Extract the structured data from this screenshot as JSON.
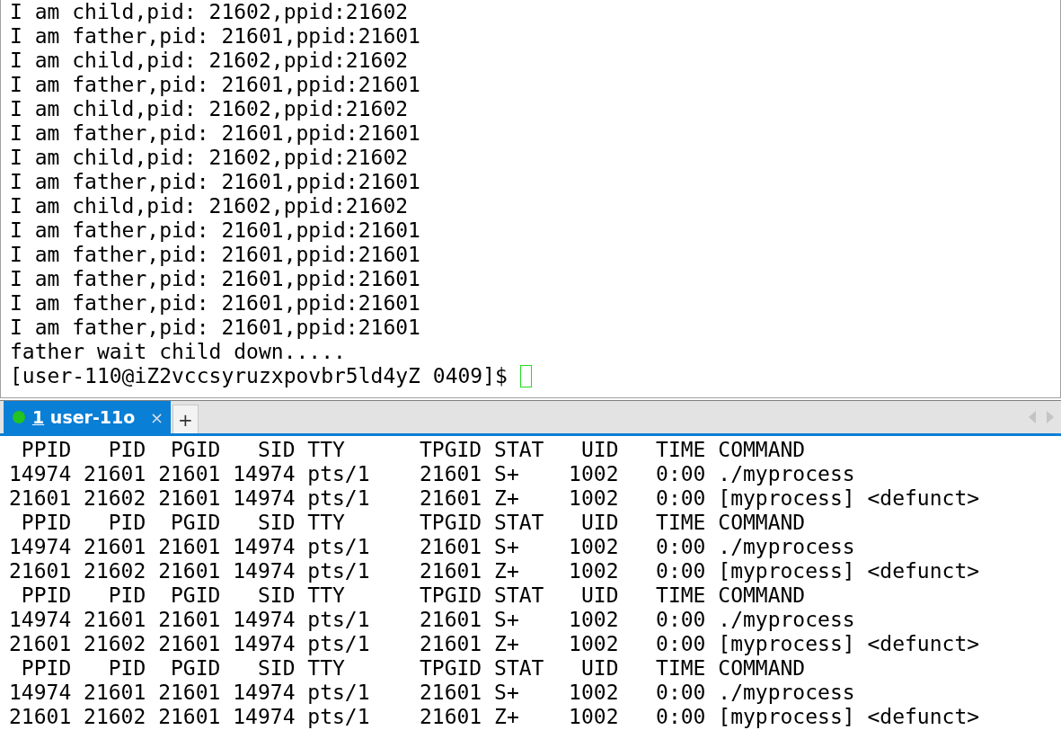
{
  "top_terminal": {
    "lines": [
      "I am child,pid: 21602,ppid:21602",
      "I am father,pid: 21601,ppid:21601",
      "I am child,pid: 21602,ppid:21602",
      "I am father,pid: 21601,ppid:21601",
      "I am child,pid: 21602,ppid:21602",
      "I am father,pid: 21601,ppid:21601",
      "I am child,pid: 21602,ppid:21602",
      "I am father,pid: 21601,ppid:21601",
      "I am child,pid: 21602,ppid:21602",
      "I am father,pid: 21601,ppid:21601",
      "I am father,pid: 21601,ppid:21601",
      "I am father,pid: 21601,ppid:21601",
      "I am father,pid: 21601,ppid:21601",
      "I am father,pid: 21601,ppid:21601",
      "father wait child down....."
    ],
    "prompt": "[user-110@iZ2vccsyruzxpovbr5ld4yZ 0409]$ "
  },
  "tabs": [
    {
      "number": "1",
      "label": "user-11o",
      "close": "×",
      "selected": true,
      "connected": true
    }
  ],
  "new_tab": "+",
  "bottom_terminal": {
    "lines": [
      " PPID   PID  PGID   SID TTY      TPGID STAT   UID   TIME COMMAND",
      "14974 21601 21601 14974 pts/1    21601 S+    1002   0:00 ./myprocess",
      "21601 21602 21601 14974 pts/1    21601 Z+    1002   0:00 [myprocess] <defunct>",
      " PPID   PID  PGID   SID TTY      TPGID STAT   UID   TIME COMMAND",
      "14974 21601 21601 14974 pts/1    21601 S+    1002   0:00 ./myprocess",
      "21601 21602 21601 14974 pts/1    21601 Z+    1002   0:00 [myprocess] <defunct>",
      " PPID   PID  PGID   SID TTY      TPGID STAT   UID   TIME COMMAND",
      "14974 21601 21601 14974 pts/1    21601 S+    1002   0:00 ./myprocess",
      "21601 21602 21601 14974 pts/1    21601 Z+    1002   0:00 [myprocess] <defunct>",
      " PPID   PID  PGID   SID TTY      TPGID STAT   UID   TIME COMMAND",
      "14974 21601 21601 14974 pts/1    21601 S+    1002   0:00 ./myprocess",
      "21601 21602 21601 14974 pts/1    21601 Z+    1002   0:00 [myprocess] <defunct>"
    ]
  }
}
